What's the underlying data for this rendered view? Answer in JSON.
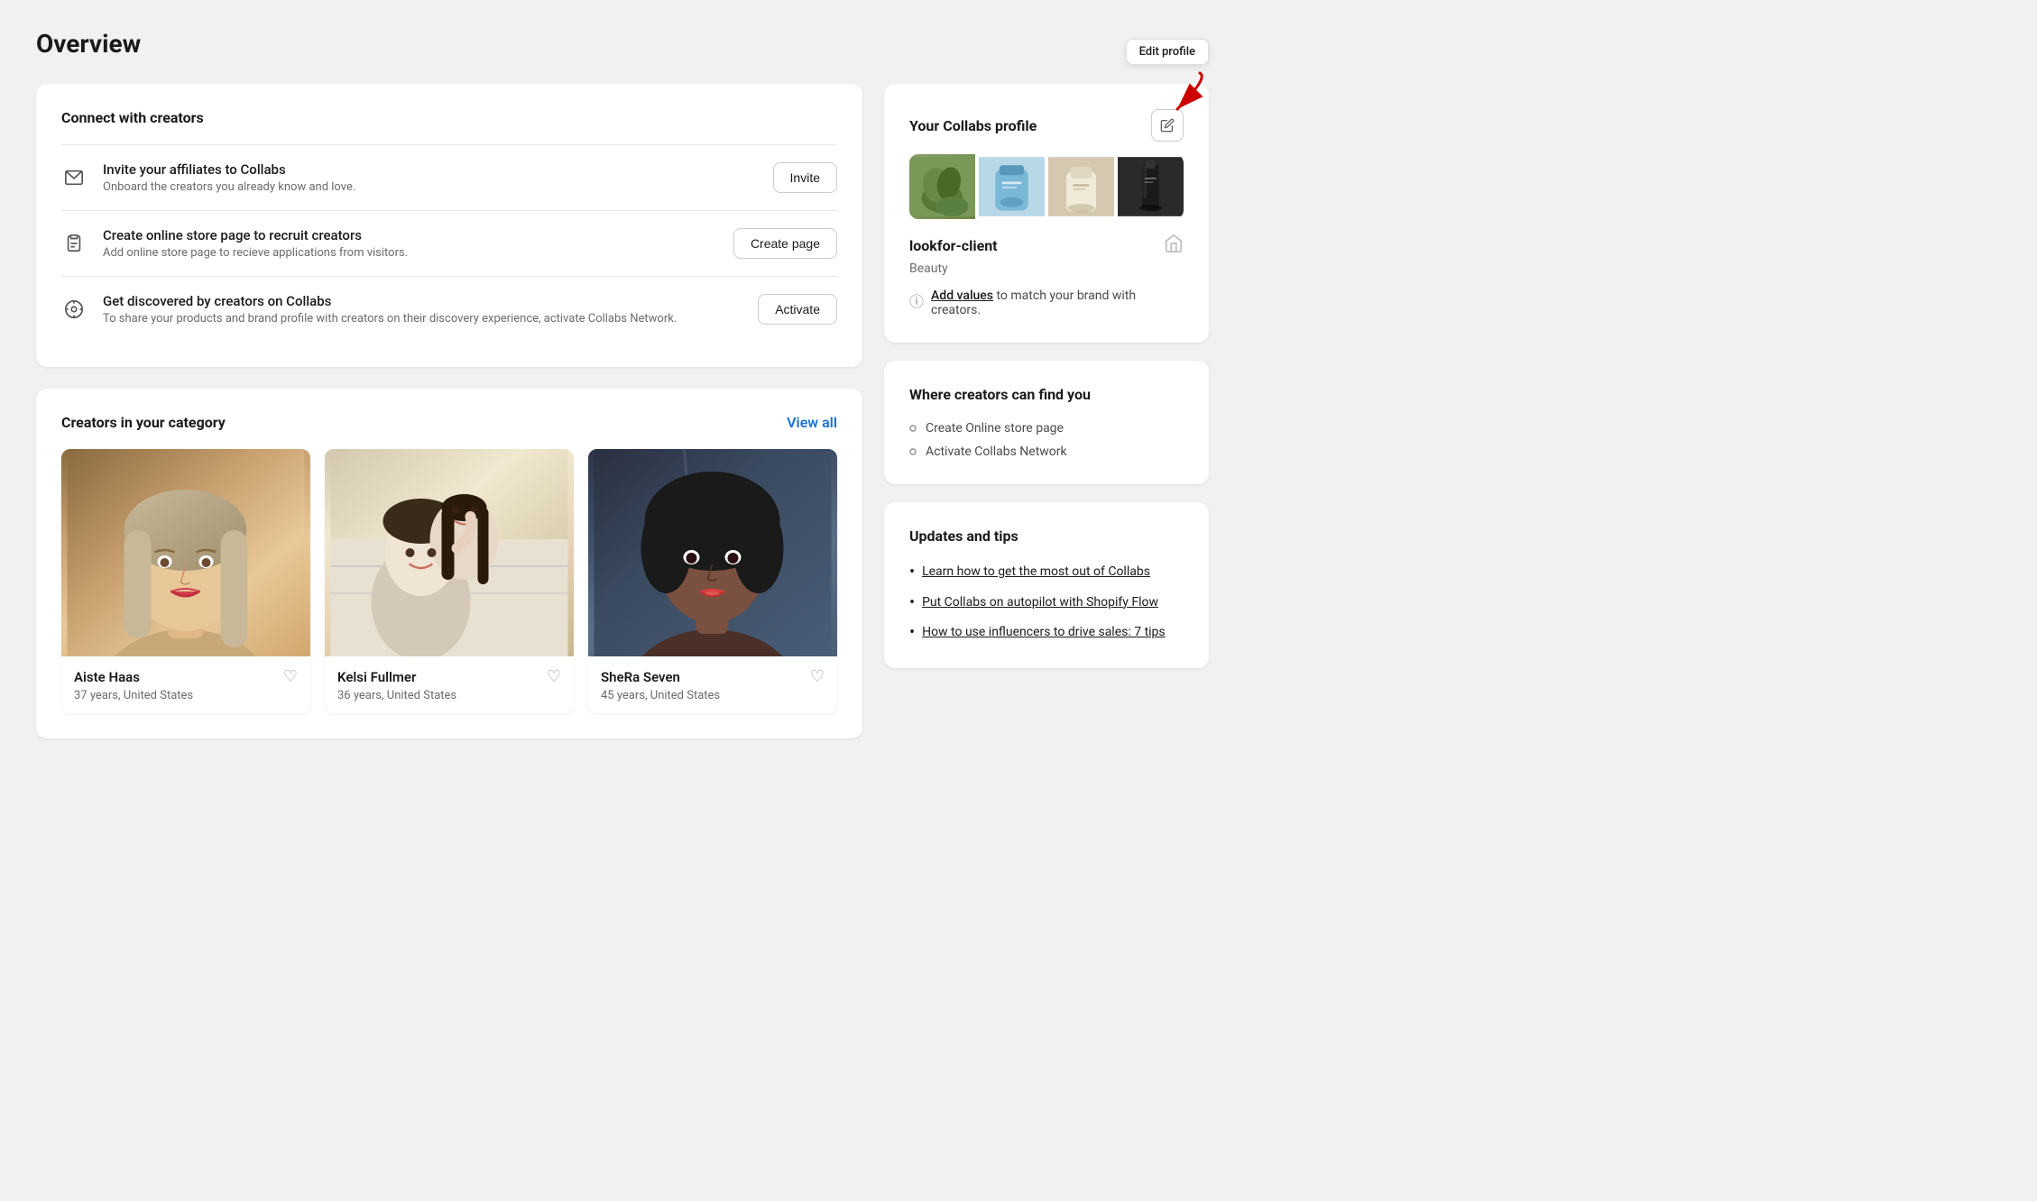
{
  "page": {
    "title": "Overview"
  },
  "connect_section": {
    "title": "Connect with creators",
    "items": [
      {
        "icon": "✉",
        "title": "Invite your affiliates to Collabs",
        "description": "Onboard the creators you already know and love.",
        "button_label": "Invite"
      },
      {
        "icon": "📋",
        "title": "Create online store page to recruit creators",
        "description": "Add online store page to recieve applications from visitors.",
        "button_label": "Create page"
      },
      {
        "icon": "◎",
        "title": "Get discovered by creators on Collabs",
        "description": "To share your products and brand profile with creators on their discovery experience, activate Collabs Network.",
        "button_label": "Activate"
      }
    ]
  },
  "creators_section": {
    "title": "Creators in your category",
    "view_all_label": "View all",
    "creators": [
      {
        "name": "Aiste Haas",
        "meta": "37 years, United States",
        "photo_class": "photo-aiste",
        "photo_emoji": "👩"
      },
      {
        "name": "Kelsi Fullmer",
        "meta": "36 years, United States",
        "photo_class": "photo-kelsi",
        "photo_emoji": "👫"
      },
      {
        "name": "SheRa Seven",
        "meta": "45 years, United States",
        "photo_class": "photo-shera",
        "photo_emoji": "👩"
      }
    ]
  },
  "collabs_profile": {
    "section_title": "Your Collabs profile",
    "edit_tooltip": "Edit profile",
    "profile_name": "lookfor-client",
    "category": "Beauty",
    "add_values_text": "Add values",
    "add_values_suffix": " to match your brand with creators.",
    "images": [
      {
        "label": "plant",
        "color1": "#8fac6c",
        "color2": "#6b9244"
      },
      {
        "label": "blue-product",
        "color1": "#7cb8d4",
        "color2": "#4a9abc"
      },
      {
        "label": "cream-product",
        "color1": "#c4a882",
        "color2": "#a08060"
      },
      {
        "label": "dark-product",
        "color1": "#2a2a2a",
        "color2": "#555"
      }
    ]
  },
  "where_section": {
    "title": "Where creators can find you",
    "items": [
      "Create Online store page",
      "Activate Collabs Network"
    ]
  },
  "tips_section": {
    "title": "Updates and tips",
    "items": [
      "Learn how to get the most out of Collabs",
      "Put Collabs on autopilot with Shopify Flow",
      "How to use influencers to drive sales: 7 tips"
    ]
  },
  "icons": {
    "edit": "✏",
    "heart": "♡",
    "info": "ⓘ",
    "shop": "🏠"
  }
}
